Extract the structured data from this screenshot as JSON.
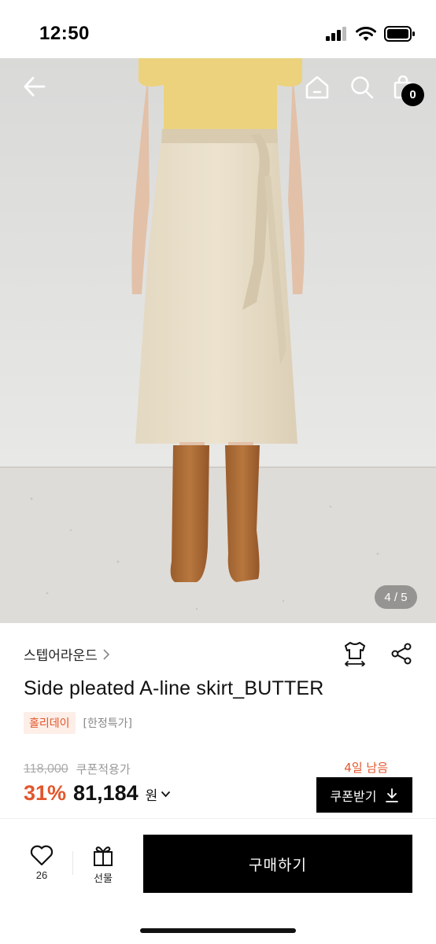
{
  "status_bar": {
    "time": "12:50"
  },
  "product_image": {
    "counter": "4 / 5",
    "cart_count": "0"
  },
  "product": {
    "brand": "스텝어라운드",
    "name": "Side pleated A-line skirt_BUTTER",
    "tags": {
      "holiday": "홀리데이",
      "limited": "[한정특가]"
    }
  },
  "price": {
    "original": "118,000",
    "coupon_price_label": "쿠폰적용가",
    "discount": "31%",
    "final": "81,184",
    "currency": "원",
    "days_left": "4일 남음",
    "coupon_button": "쿠폰받기"
  },
  "bottom_bar": {
    "like_count": "26",
    "gift_label": "선물",
    "buy_button": "구매하기"
  },
  "colors": {
    "accent": "#e2562b",
    "button_bg": "#000000"
  }
}
